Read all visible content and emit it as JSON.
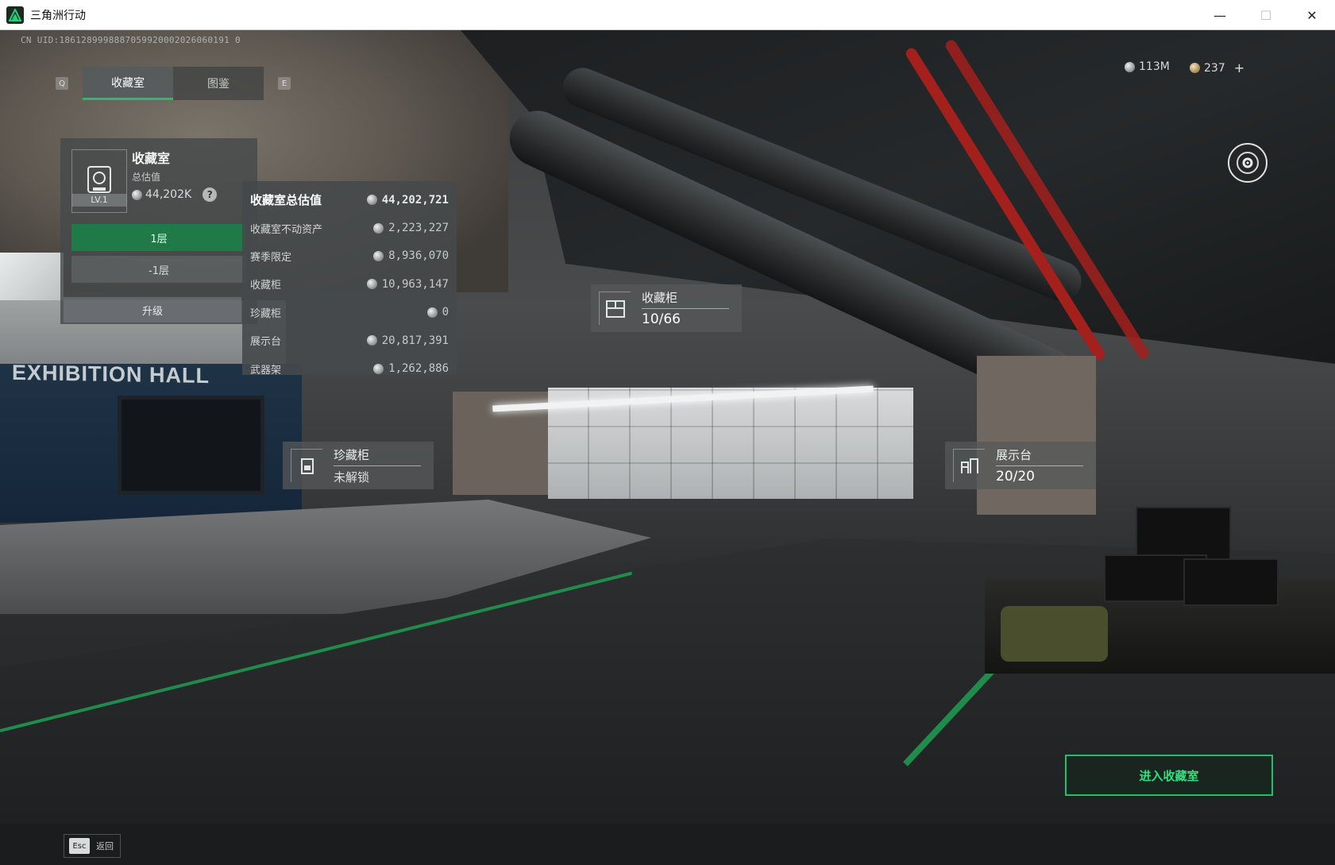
{
  "window": {
    "title": "三角洲行动",
    "min_glyph": "—",
    "max_glyph": "☐",
    "close_glyph": "✕"
  },
  "uid": "CN UID:1861289998887059920002026060191 0",
  "tabs": {
    "left_key": "Q",
    "right_key": "E",
    "items": [
      {
        "label": "收藏室",
        "active": true
      },
      {
        "label": "图鉴",
        "active": false
      }
    ]
  },
  "hall_card": {
    "name": "收藏室",
    "sub_label": "总估值",
    "value": "44,202K",
    "level": "LV.1",
    "help": "?",
    "floors": [
      "1层",
      "-1层"
    ],
    "upgrade": "升级"
  },
  "value_panel": {
    "rows": [
      {
        "label": "收藏室总估值",
        "amount": "44,202,721"
      },
      {
        "label": "收藏室不动资产",
        "amount": "2,223,227"
      },
      {
        "label": "赛季限定",
        "amount": "8,936,070"
      },
      {
        "label": "收藏柜",
        "amount": "10,963,147"
      },
      {
        "label": "珍藏柜",
        "amount": "0"
      },
      {
        "label": "展示台",
        "amount": "20,817,391"
      },
      {
        "label": "武器架",
        "amount": "1,262,886"
      }
    ]
  },
  "hotspots": {
    "cabinet": {
      "name": "收藏柜",
      "value": "10/66",
      "icon": "cabinet-icon"
    },
    "rare": {
      "name": "珍藏柜",
      "value": "未解锁",
      "icon": "lock-cabinet-icon"
    },
    "display": {
      "name": "展示台",
      "value": "20/20",
      "icon": "display-stand-icon"
    }
  },
  "scene_text": {
    "hall_sign": "EXHIBITION HALL"
  },
  "currency": {
    "silver": "113M",
    "gold": "237",
    "plus": "+"
  },
  "enter_button": "进入收藏室",
  "back": {
    "key": "Esc",
    "label": "返回"
  },
  "colors": {
    "accent_green": "#1fc16a",
    "panel_bg": "#46494b"
  }
}
